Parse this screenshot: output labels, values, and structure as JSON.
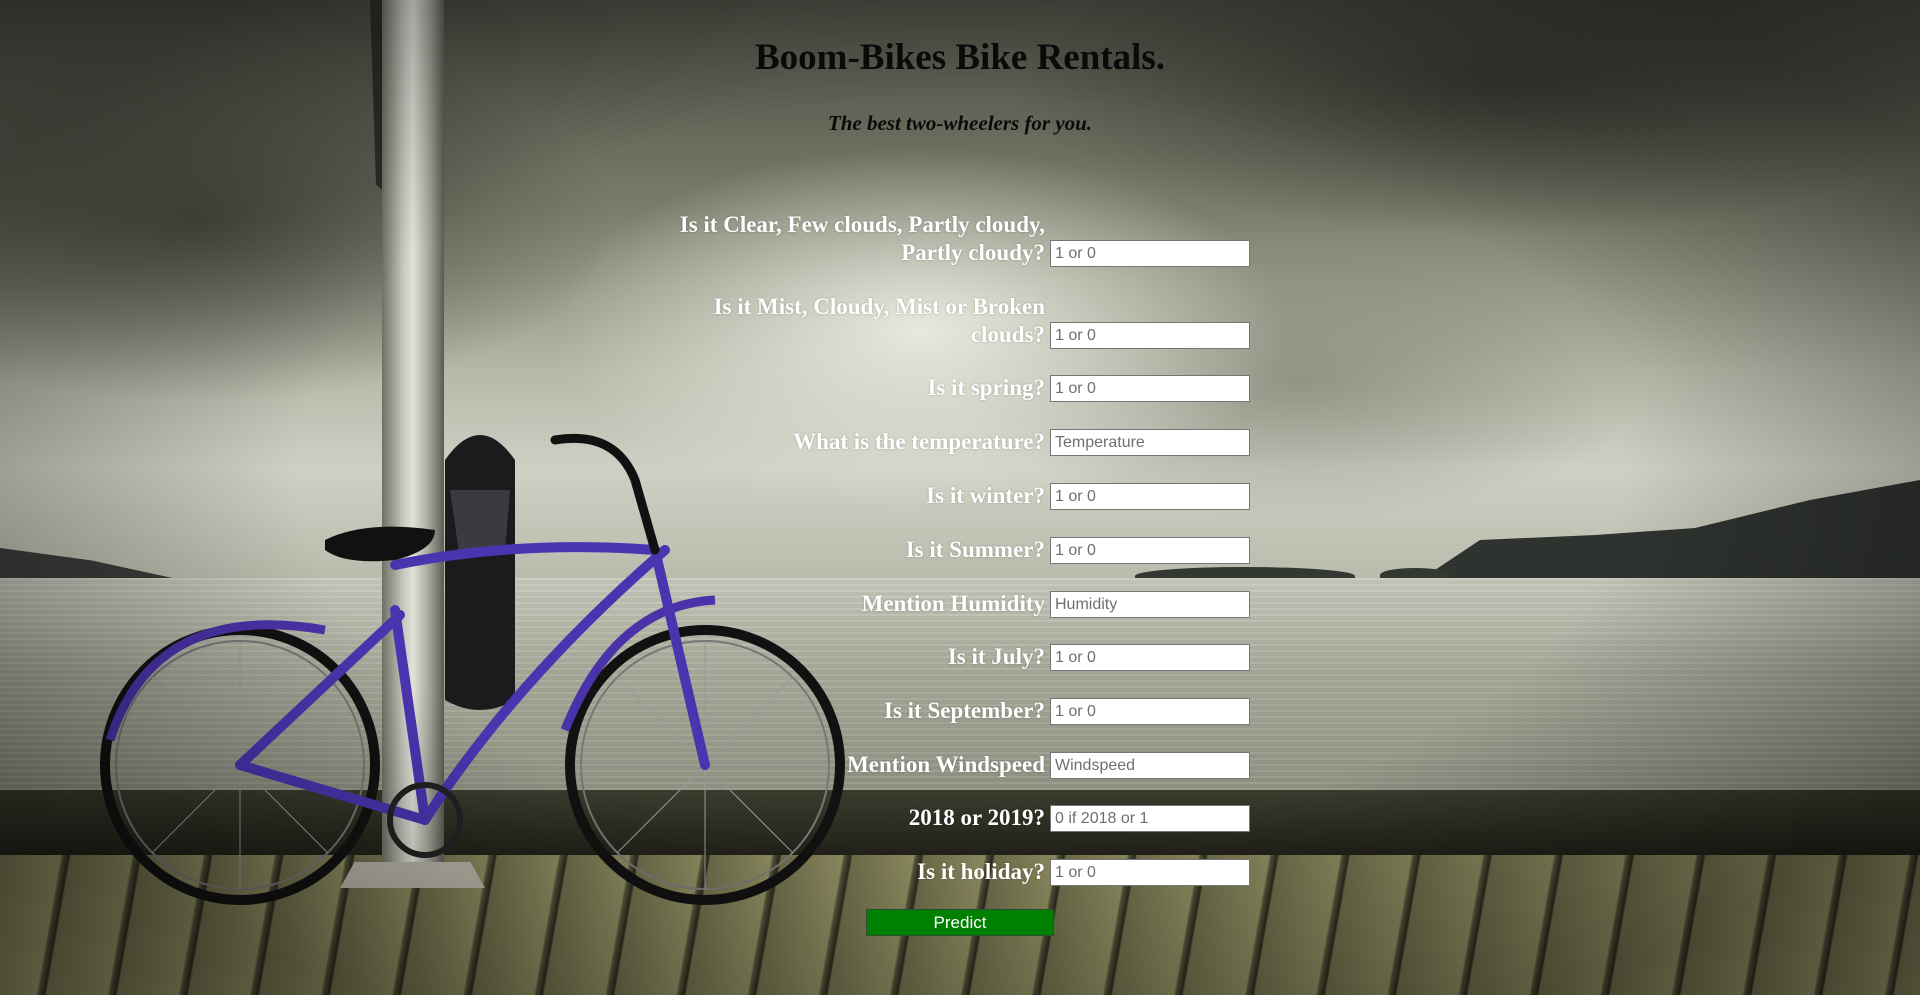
{
  "page": {
    "title": "Boom-Bikes Bike Rentals.",
    "subtitle": "The best two-wheelers for you."
  },
  "form": {
    "fields": [
      {
        "label": "Is it Clear, Few clouds, Partly cloudy, Partly cloudy?",
        "placeholder": "1 or 0",
        "value": ""
      },
      {
        "label": "Is it Mist, Cloudy, Mist or Broken clouds?",
        "placeholder": "1 or 0",
        "value": ""
      },
      {
        "label": "Is it spring?",
        "placeholder": "1 or 0",
        "value": ""
      },
      {
        "label": "What is the temperature?",
        "placeholder": "Temperature",
        "value": ""
      },
      {
        "label": "Is it winter?",
        "placeholder": "1 or 0",
        "value": ""
      },
      {
        "label": "Is it Summer?",
        "placeholder": "1 or 0",
        "value": ""
      },
      {
        "label": "Mention Humidity",
        "placeholder": "Humidity",
        "value": ""
      },
      {
        "label": "Is it July?",
        "placeholder": "1 or 0",
        "value": ""
      },
      {
        "label": "Is it September?",
        "placeholder": "1 or 0",
        "value": ""
      },
      {
        "label": "Mention Windspeed",
        "placeholder": "Windspeed",
        "value": ""
      },
      {
        "label": "2018 or 2019?",
        "placeholder": "0 if 2018 or 1",
        "value": ""
      },
      {
        "label": "Is it holiday?",
        "placeholder": "1 or 0",
        "value": ""
      }
    ],
    "submit_label": "Predict"
  },
  "colors": {
    "button_bg": "#008000",
    "label_text": "#ffffff",
    "heading_text": "#0a0a0a"
  }
}
